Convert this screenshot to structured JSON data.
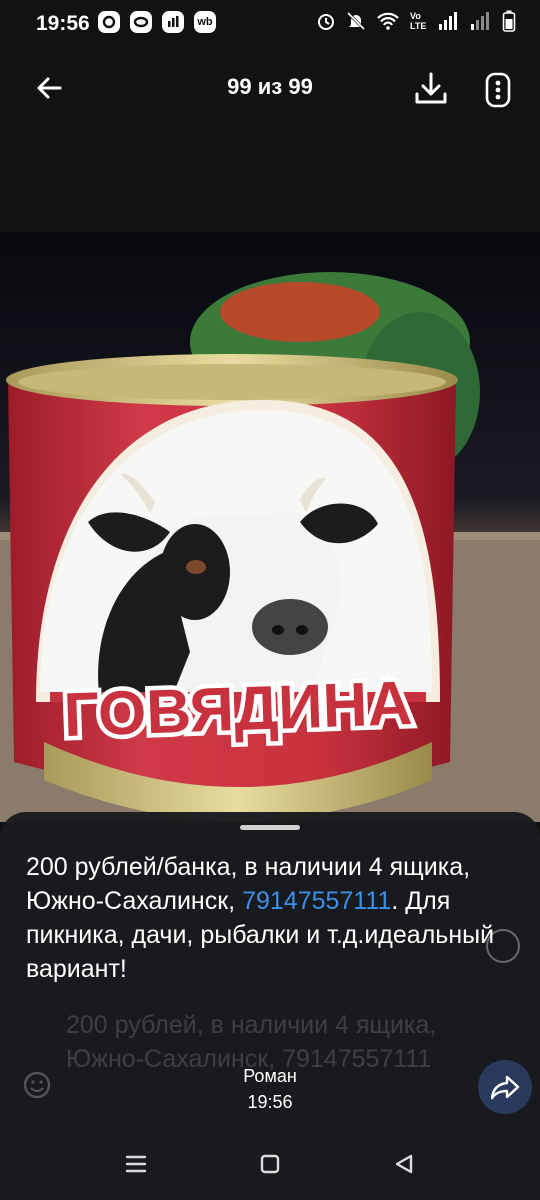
{
  "status_bar": {
    "time": "19:56",
    "app_icons": [
      "messenger-icon",
      "o-app-icon",
      "bank-app-icon",
      "wb-app-icon"
    ],
    "wb_label": "wb",
    "lte_label": "Vo LTE",
    "system_icons": [
      "alarm-icon",
      "mute-icon",
      "wifi-icon",
      "signal-icon"
    ]
  },
  "header": {
    "counter": "99 из 99"
  },
  "photo": {
    "label_text": "ГОВЯДИНА",
    "can_color": "#c8323e"
  },
  "message": {
    "caption_part1": "200 рублей/банка, в наличии 4 ящика, Южно-Сахалинск, ",
    "phone": "79147557111",
    "caption_part2": ". Для пикника, дачи, рыбалки и т.д.идеальный вариант!",
    "background_text": "200 рублей, в наличии 4 ящика, Южно-Сахалинск, 79147557111",
    "sender": "Роман",
    "time": "19:56"
  },
  "colors": {
    "background": "#111214",
    "link": "#3b8fe8",
    "share_button": "#2a3a5e"
  }
}
